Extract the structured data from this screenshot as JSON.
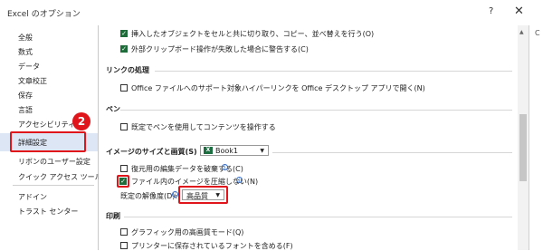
{
  "window": {
    "title": "Excel のオプション",
    "help": "?",
    "close": "✕"
  },
  "sidebar": {
    "items": [
      {
        "label": "全般"
      },
      {
        "label": "数式"
      },
      {
        "label": "データ"
      },
      {
        "label": "文章校正"
      },
      {
        "label": "保存"
      },
      {
        "label": "言語"
      },
      {
        "label": "アクセシビリティ"
      },
      {
        "label": "詳細設定",
        "selected": true
      },
      {
        "label": "リボンのユーザー設定"
      },
      {
        "label": "クイック アクセス ツール バー"
      },
      {
        "label": "アドイン"
      },
      {
        "label": "トラスト センター"
      }
    ]
  },
  "badge": "2",
  "options": {
    "row1": "挿入したオブジェクトをセルと共に切り取り、コピー、並べ替えを行う(O)",
    "row2": "外部クリップボード操作が失敗した場合に警告する(C)",
    "link_section": "リンクの処理",
    "link_row": "Office ファイルへのサポート対象ハイパーリンクを Office デスクトップ アプリで開く(N)",
    "pen_section": "ペン",
    "pen_row": "既定でペンを使用してコンテンツを操作する",
    "image_section": "イメージのサイズと画質(S)",
    "book": "Book1",
    "discard_row": "復元用の編集データを破棄する(C)",
    "compress_row": "ファイル内のイメージを圧縮しない(N)",
    "resolution_label": "既定の解像度(D):",
    "resolution_value": "高品質",
    "print_section": "印刷",
    "print_row1": "グラフィック用の高画質モード(Q)",
    "print_row2": "プリンターに保存されているフォントを含める(F)"
  },
  "colors": {
    "accent_red": "#e0151b",
    "selected_bg": "#dde6f5",
    "check_green": "#1e6c3a"
  }
}
